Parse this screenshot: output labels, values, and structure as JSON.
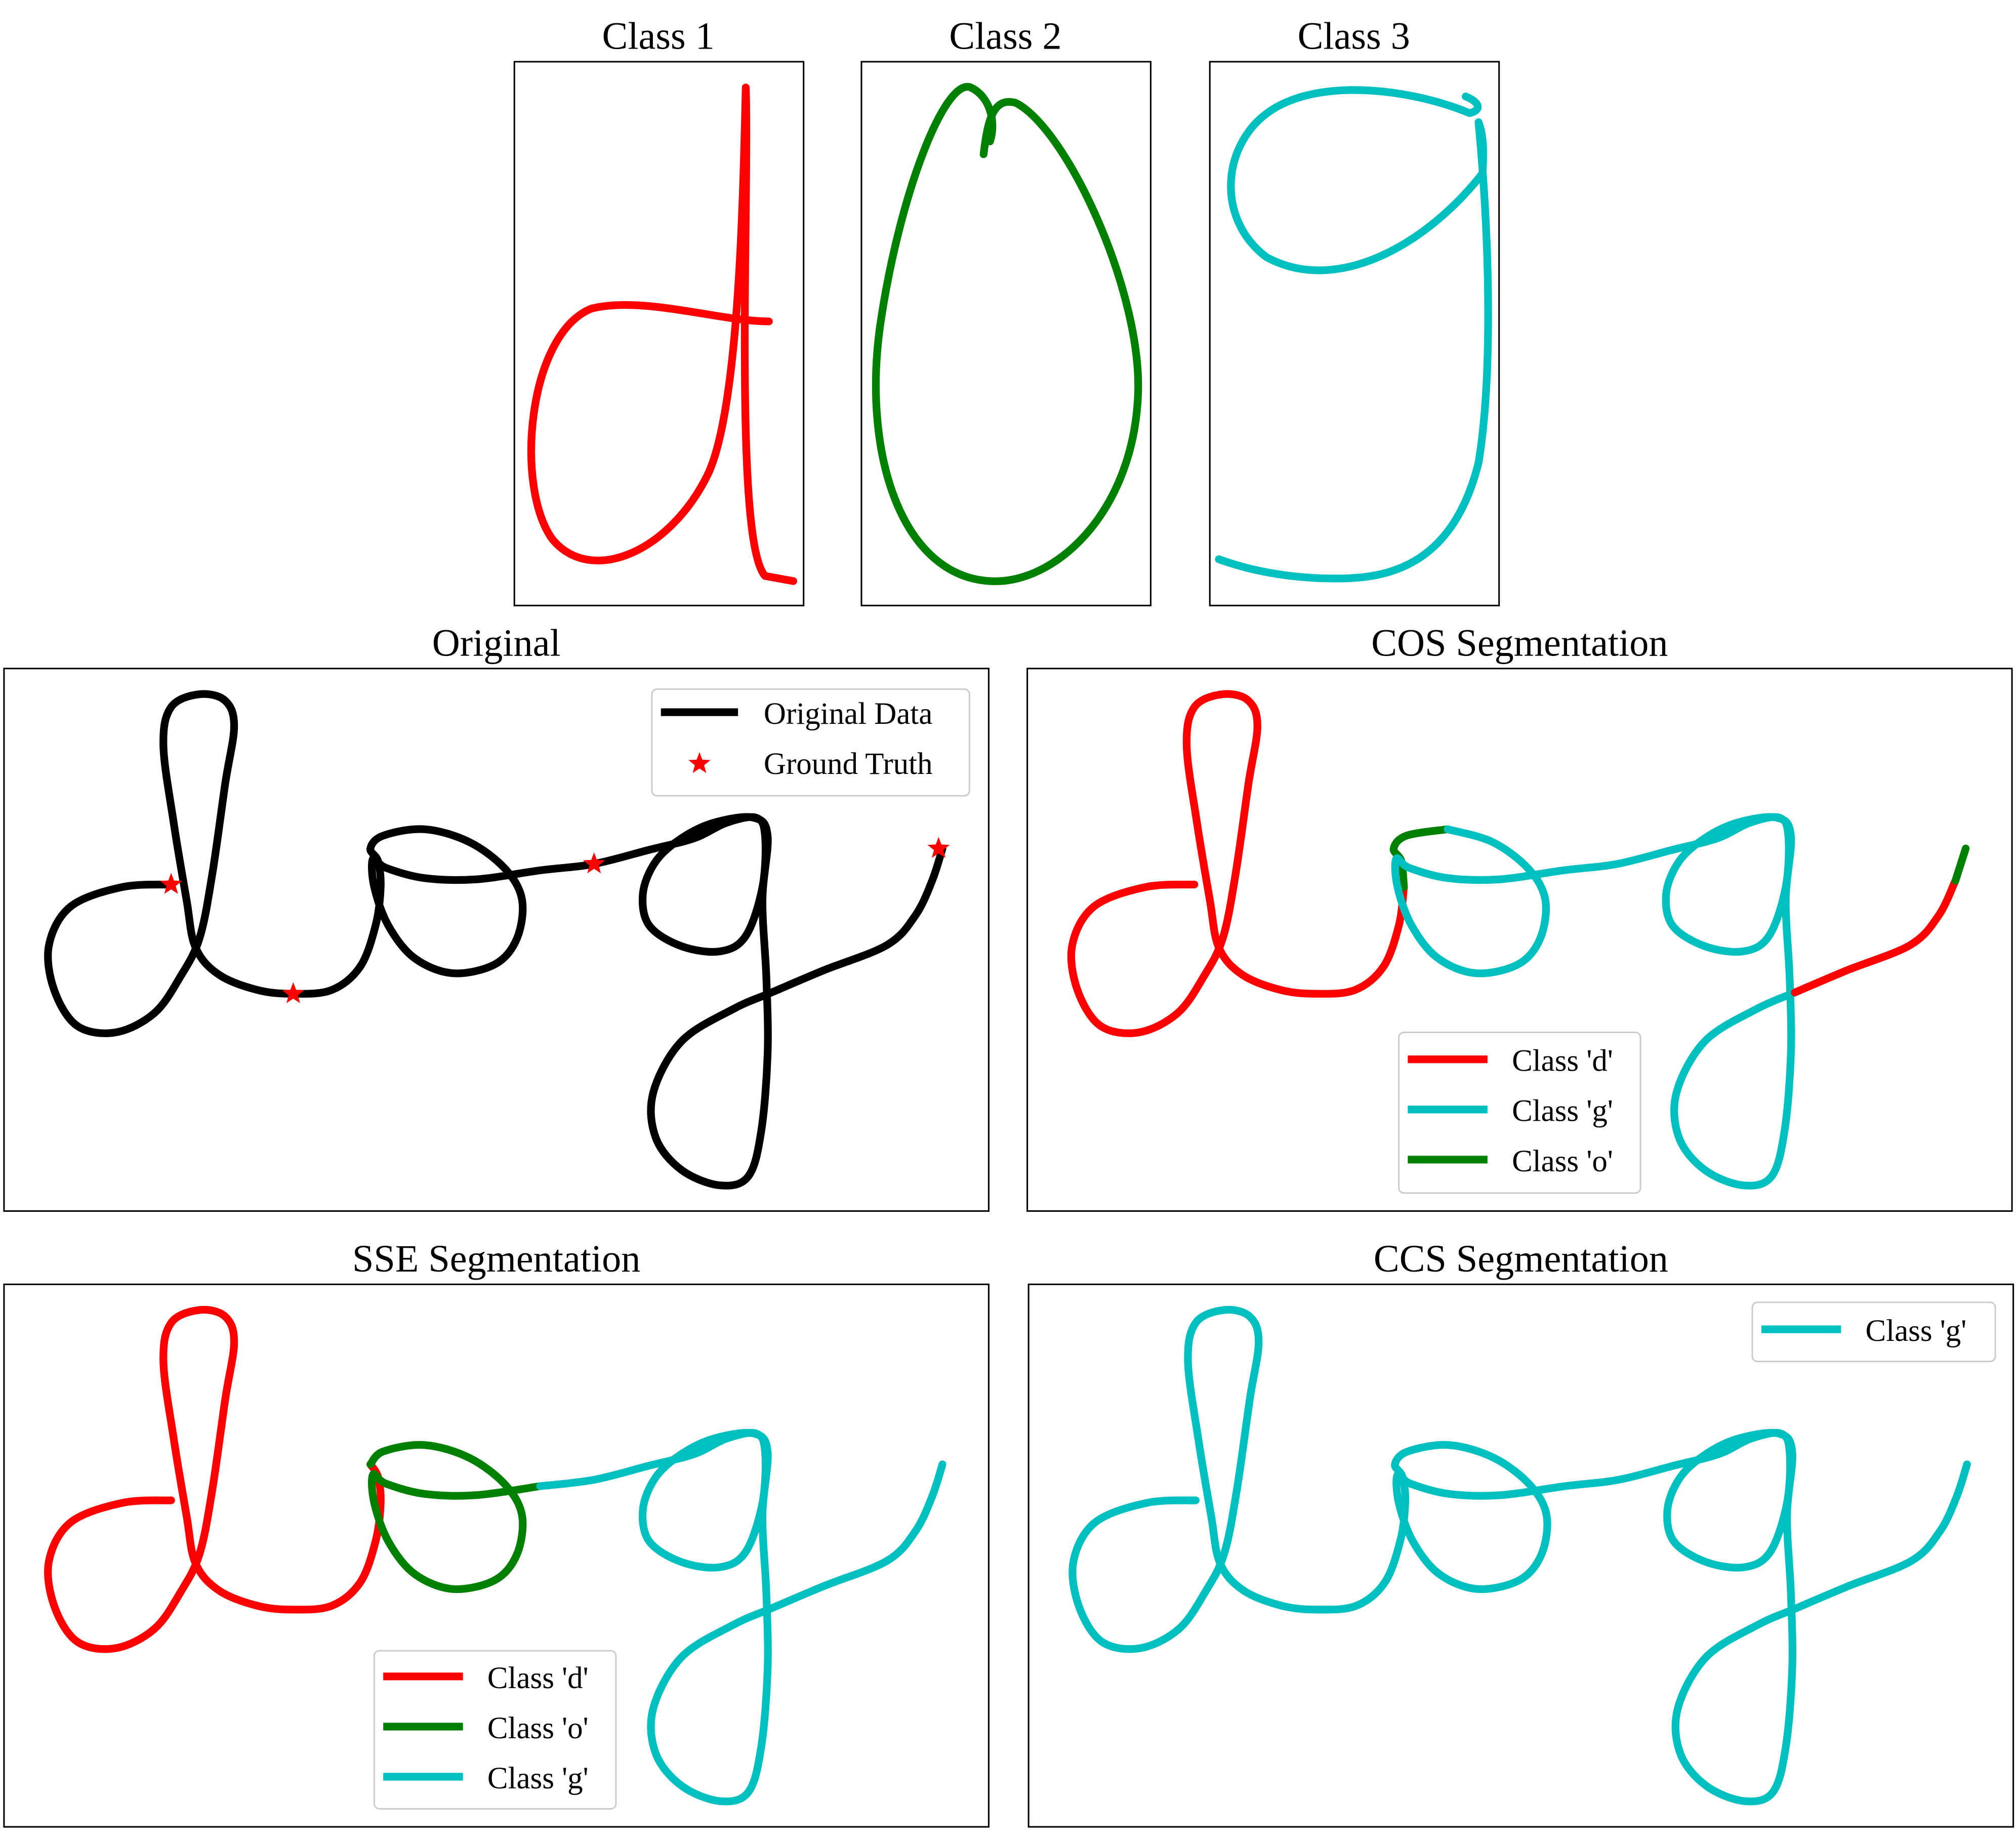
{
  "class_panels": [
    {
      "title": "Class 1",
      "color": "#ff0000"
    },
    {
      "title": "Class 2",
      "color": "#008000"
    },
    {
      "title": "Class 3",
      "color": "#00bfbf"
    }
  ],
  "panels": {
    "original": {
      "title": "Original",
      "legend": [
        "Original Data",
        "Ground Truth"
      ],
      "line_color": "#000000",
      "marker_color": "#ff0000",
      "marker": "star"
    },
    "cos": {
      "title": "COS Segmentation",
      "legend": [
        "Class 'd'",
        "Class 'g'",
        "Class 'o'"
      ]
    },
    "sse": {
      "title": "SSE Segmentation",
      "legend": [
        "Class 'd'",
        "Class 'o'",
        "Class 'g'"
      ]
    },
    "ccs": {
      "title": "CCS Segmentation",
      "legend": [
        "Class 'g'"
      ]
    }
  },
  "colors": {
    "d": "#ff0000",
    "o": "#008000",
    "g": "#00bfbf"
  }
}
